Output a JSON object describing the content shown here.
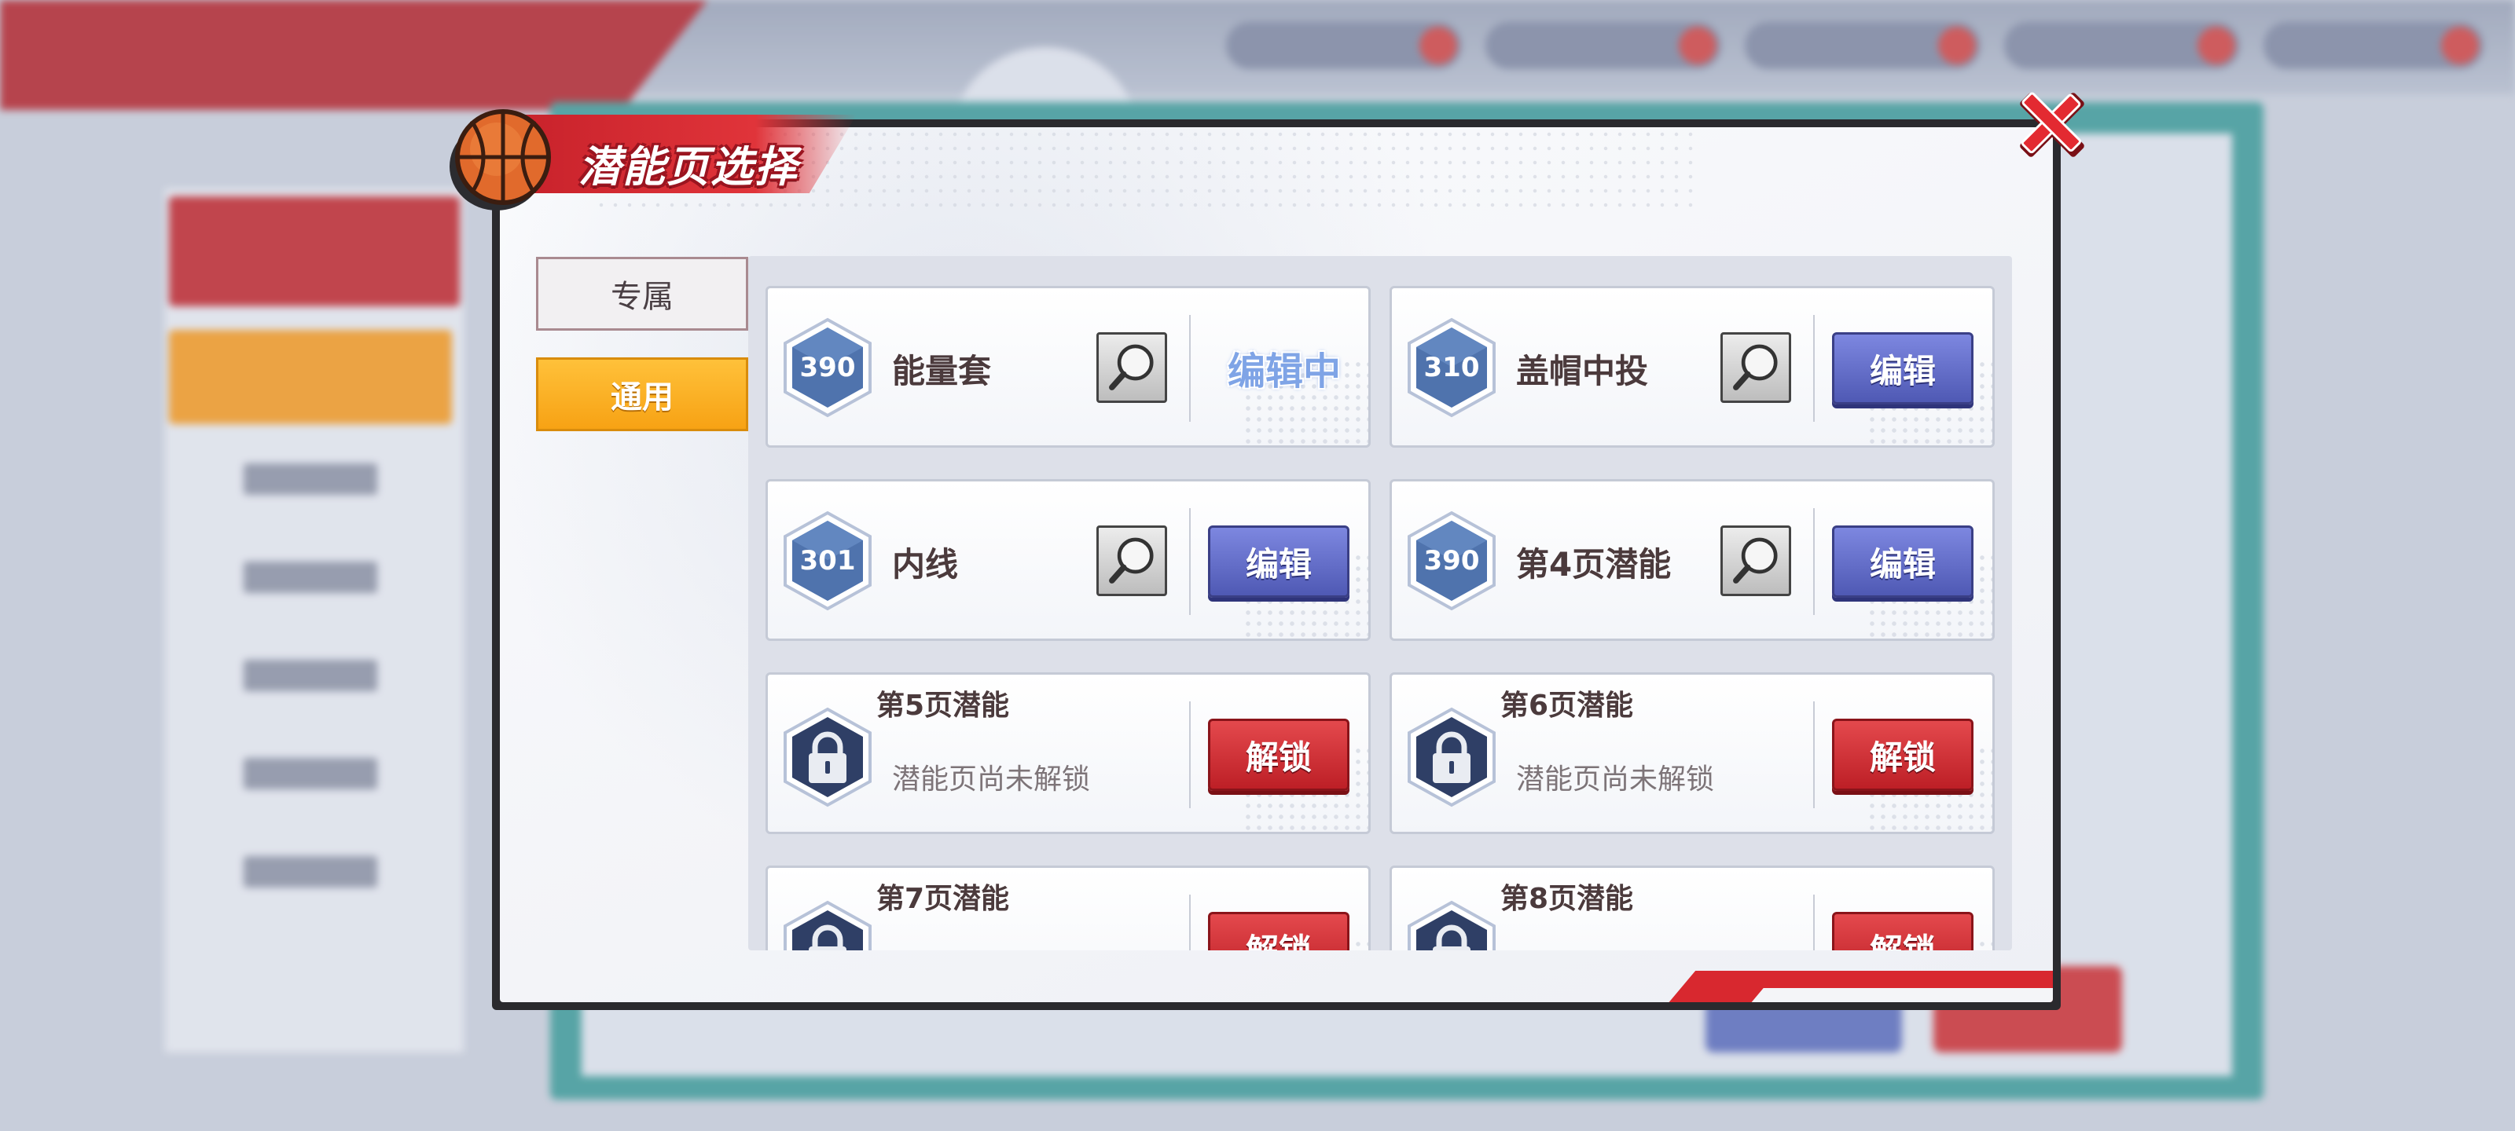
{
  "dialog": {
    "title": "潜能页选择"
  },
  "tabs": [
    {
      "label": "专属",
      "active": false
    },
    {
      "label": "通用",
      "active": true
    }
  ],
  "cards": [
    {
      "score": "390",
      "name": "能量套",
      "status": "编辑中"
    },
    {
      "score": "310",
      "name": "盖帽中投",
      "button": "编辑"
    },
    {
      "score": "301",
      "name": "内线",
      "button": "编辑"
    },
    {
      "score": "390",
      "name": "第4页潜能",
      "button": "编辑"
    },
    {
      "title": "第5页潜能",
      "subtitle": "潜能页尚未解锁",
      "button": "解锁"
    },
    {
      "title": "第6页潜能",
      "subtitle": "潜能页尚未解锁",
      "button": "解锁"
    },
    {
      "title": "第7页潜能",
      "button": "解锁"
    },
    {
      "title": "第8页潜能",
      "button": "解锁"
    }
  ],
  "colors": {
    "accent_red": "#d8282f",
    "tab_active": "#f7a214",
    "button_blue": "#5b64c2",
    "button_red": "#cf2c32",
    "hex_blue": "#4f73ad",
    "hex_dark": "#2f3f66"
  },
  "icons": {
    "close": "close-icon",
    "magnifier": "magnifier-icon",
    "lock": "lock-icon",
    "basketball": "basketball-icon"
  }
}
